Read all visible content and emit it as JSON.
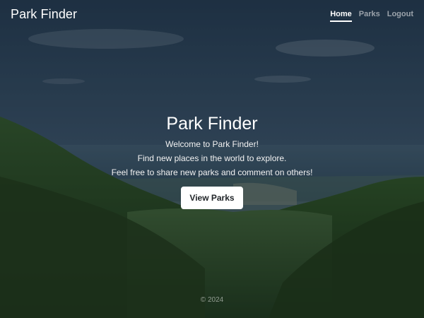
{
  "header": {
    "brand": "Park Finder",
    "nav": [
      {
        "label": "Home",
        "active": true
      },
      {
        "label": "Parks",
        "active": false
      },
      {
        "label": "Logout",
        "active": false
      }
    ]
  },
  "hero": {
    "title": "Park Finder",
    "lines": [
      "Welcome to Park Finder!",
      "Find new places in the world to explore.",
      "Feel free to share new parks and comment on others!"
    ],
    "button_label": "View Parks"
  },
  "footer": {
    "copyright": "© 2024"
  },
  "colors": {
    "overlay": "#000000",
    "button_bg": "#ffffff",
    "button_text": "#212529",
    "sky_top": "#2f4b66",
    "sea": "#3a5e7a",
    "forest": "#2c4a2a"
  },
  "background": {
    "image": "mountain-forest-landscape-photo"
  }
}
